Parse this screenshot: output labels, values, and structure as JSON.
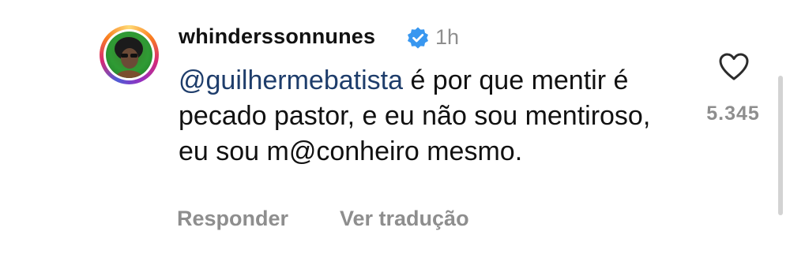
{
  "comment": {
    "username": "whinderssonnunes",
    "verified": true,
    "time": "1h",
    "mention": "@guilhermebatista",
    "text": " é por que mentir é pecado pastor, e eu não sou mentiroso, eu sou m@conheiro mesmo.",
    "likes": "5.345",
    "actions": {
      "reply": "Responder",
      "translate": "Ver tradução"
    }
  },
  "colors": {
    "mention": "#1e3d6b",
    "muted": "#8e8e8e",
    "verified": "#3897f0"
  },
  "icons": {
    "like": "heart-outline-icon",
    "verified": "verified-badge-icon"
  }
}
